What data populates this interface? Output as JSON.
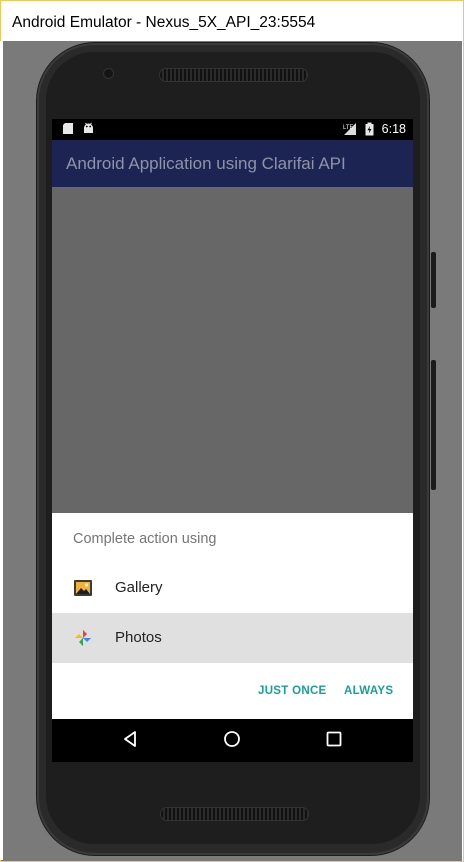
{
  "window": {
    "title": "Android Emulator - Nexus_5X_API_23:5554"
  },
  "status_bar": {
    "time": "6:18",
    "left_icons": [
      "sd-card-icon",
      "android-robot-icon"
    ],
    "right_icons": [
      "lte-signal-icon",
      "battery-charging-icon"
    ]
  },
  "app_bar": {
    "title": "Android Application using Clarifai API"
  },
  "chooser": {
    "title": "Complete action using",
    "options": [
      {
        "label": "Gallery",
        "icon": "gallery-icon",
        "selected": false
      },
      {
        "label": "Photos",
        "icon": "photos-pinwheel-icon",
        "selected": true
      }
    ],
    "actions": {
      "just_once": "JUST ONCE",
      "always": "ALWAYS"
    },
    "accent_color": "#17a192"
  },
  "nav_bar": {
    "icons": [
      "back-icon",
      "home-icon",
      "recents-icon"
    ]
  },
  "colors": {
    "app_bar": "#1c2453",
    "scrim": "#676767"
  }
}
